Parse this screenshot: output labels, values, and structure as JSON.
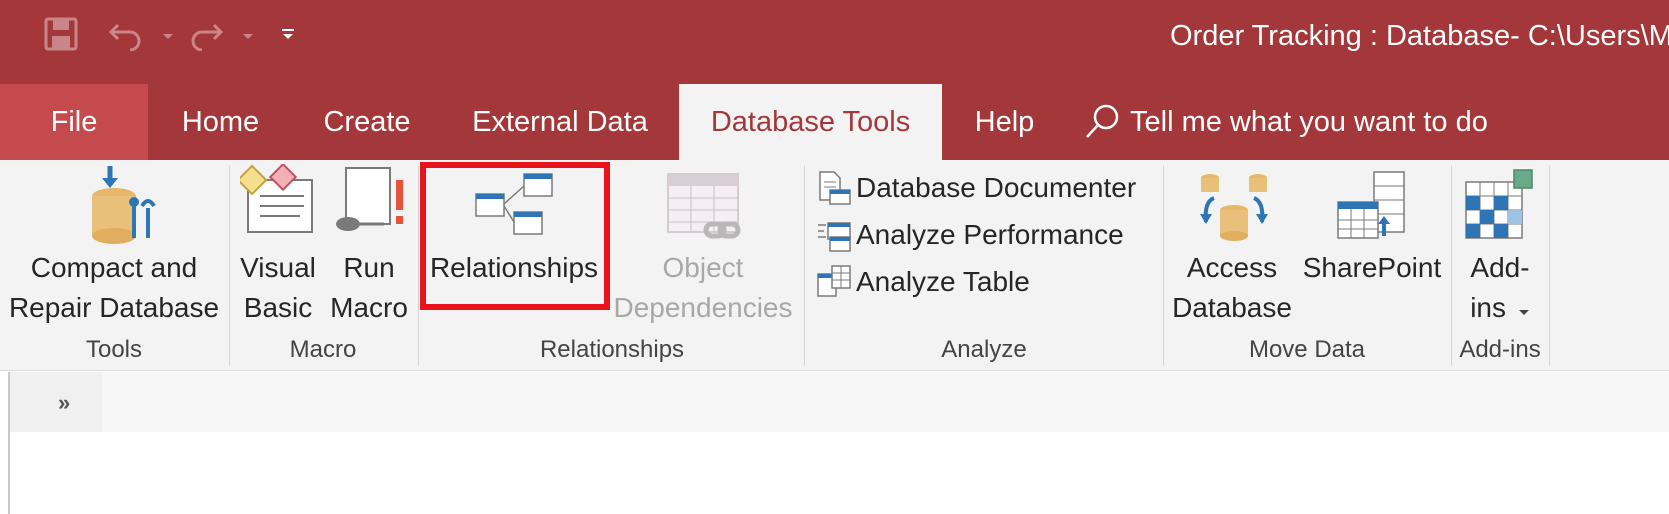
{
  "window": {
    "title": "Order Tracking : Database- C:\\Users\\M",
    "colors": {
      "accent": "#a4373a",
      "file_tab": "#c44a4e",
      "ribbon_bg": "#f3f3f3",
      "highlight": "#e8131b"
    }
  },
  "qat": {
    "icons": [
      "save-icon",
      "undo-icon",
      "redo-icon",
      "customize-icon"
    ]
  },
  "tabs": [
    {
      "label": "File"
    },
    {
      "label": "Home"
    },
    {
      "label": "Create"
    },
    {
      "label": "External Data"
    },
    {
      "label": "Database Tools",
      "active": true
    },
    {
      "label": "Help"
    }
  ],
  "tell_me": {
    "label": "Tell me what you want to do"
  },
  "ribbon": {
    "tools": {
      "group_label": "Tools",
      "compact_repair": {
        "line1": "Compact and",
        "line2": "Repair Database"
      }
    },
    "macro": {
      "group_label": "Macro",
      "visual_basic": {
        "line1": "Visual",
        "line2": "Basic"
      },
      "run_macro": {
        "line1": "Run",
        "line2": "Macro"
      }
    },
    "relationships": {
      "group_label": "Relationships",
      "relationships_btn": {
        "label": "Relationships"
      },
      "object_dependencies": {
        "line1": "Object",
        "line2": "Dependencies"
      }
    },
    "analyze": {
      "group_label": "Analyze",
      "documenter": "Database Documenter",
      "performance": "Analyze Performance",
      "table": "Analyze Table"
    },
    "move_data": {
      "group_label": "Move Data",
      "access_db": {
        "line1": "Access",
        "line2": "Database"
      },
      "sharepoint": {
        "line1": "SharePoint"
      }
    },
    "addins": {
      "group_label": "Add-ins",
      "addins_btn": {
        "line1": "Add-",
        "line2": "ins"
      }
    }
  },
  "nav_pane": {
    "toggle_glyph": "»"
  }
}
